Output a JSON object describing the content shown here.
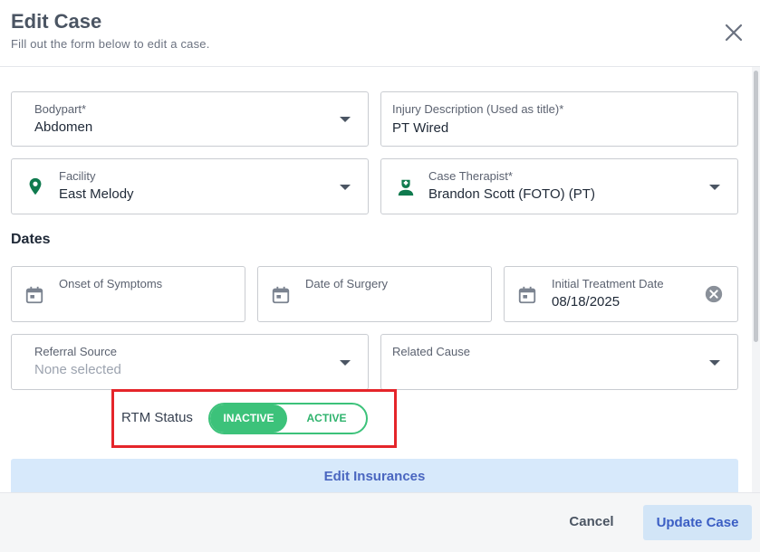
{
  "header": {
    "title": "Edit Case",
    "subtitle": "Fill out the form below to edit a case.",
    "close_icon": "close-icon"
  },
  "fields": {
    "bodypart": {
      "label": "Bodypart*",
      "value": "Abdomen"
    },
    "injury_description": {
      "label": "Injury Description (Used as title)*",
      "value": "PT Wired"
    },
    "facility": {
      "label": "Facility",
      "value": "East Melody",
      "icon": "map-pin-icon"
    },
    "case_therapist": {
      "label": "Case Therapist*",
      "value": "Brandon Scott (FOTO) (PT)",
      "icon": "doctor-icon"
    }
  },
  "dates": {
    "section_title": "Dates",
    "onset": {
      "label": "Onset of Symptoms",
      "value": "",
      "icon": "calendar-icon"
    },
    "surgery": {
      "label": "Date of Surgery",
      "value": "",
      "icon": "calendar-icon"
    },
    "initial_treatment": {
      "label": "Initial Treatment Date",
      "value": "08/18/2025",
      "icon": "calendar-icon",
      "clear_icon": "clear-circle-icon"
    }
  },
  "referral": {
    "source": {
      "label": "Referral Source",
      "placeholder": "None selected"
    },
    "related_cause": {
      "label": "Related Cause",
      "value": ""
    }
  },
  "rtm": {
    "label": "RTM Status",
    "options": [
      "INACTIVE",
      "ACTIVE"
    ],
    "selected": "INACTIVE"
  },
  "edit_insurances_label": "Edit Insurances",
  "footer": {
    "cancel_label": "Cancel",
    "update_label": "Update Case"
  },
  "colors": {
    "accent_green": "#3cc27a",
    "icon_green": "#0f7a4e",
    "highlight_red": "#e5252a",
    "light_blue": "#d7e9fb",
    "link_blue": "#4a66c0"
  }
}
